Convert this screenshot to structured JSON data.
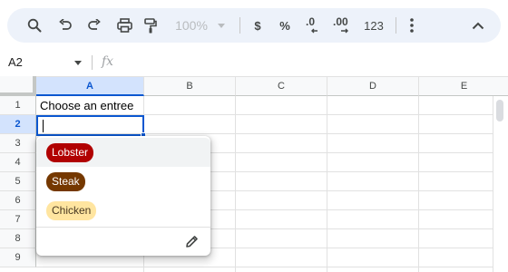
{
  "toolbar": {
    "zoom": "100%",
    "currency_label": "$",
    "percent_label": "%",
    "decrease_decimal_label": ".0",
    "increase_decimal_label": ".00",
    "format_number_label": "123"
  },
  "formula_bar": {
    "name_box": "A2",
    "fx_label": "fx"
  },
  "columns": [
    "A",
    "B",
    "C",
    "D",
    "E"
  ],
  "rows": [
    "1",
    "2",
    "3",
    "4",
    "5",
    "6",
    "7",
    "8",
    "9"
  ],
  "cells": {
    "A1": "Choose an entree",
    "A2": ""
  },
  "dropdown": {
    "options": [
      {
        "label": "Lobster",
        "bg": "#b10202",
        "fg": "#ffffff"
      },
      {
        "label": "Steak",
        "bg": "#753800",
        "fg": "#ffffff"
      },
      {
        "label": "Chicken",
        "bg": "#ffe5a0",
        "fg": "#473821"
      }
    ]
  },
  "colors": {
    "accent": "#0b57d0",
    "toolbar_bg": "#edf2fa",
    "selected_header": "#d3e3fd"
  },
  "icons": [
    "search-icon",
    "undo-icon",
    "redo-icon",
    "print-icon",
    "paint-format-icon",
    "more-vert-icon",
    "chevron-up-icon",
    "edit-icon"
  ]
}
